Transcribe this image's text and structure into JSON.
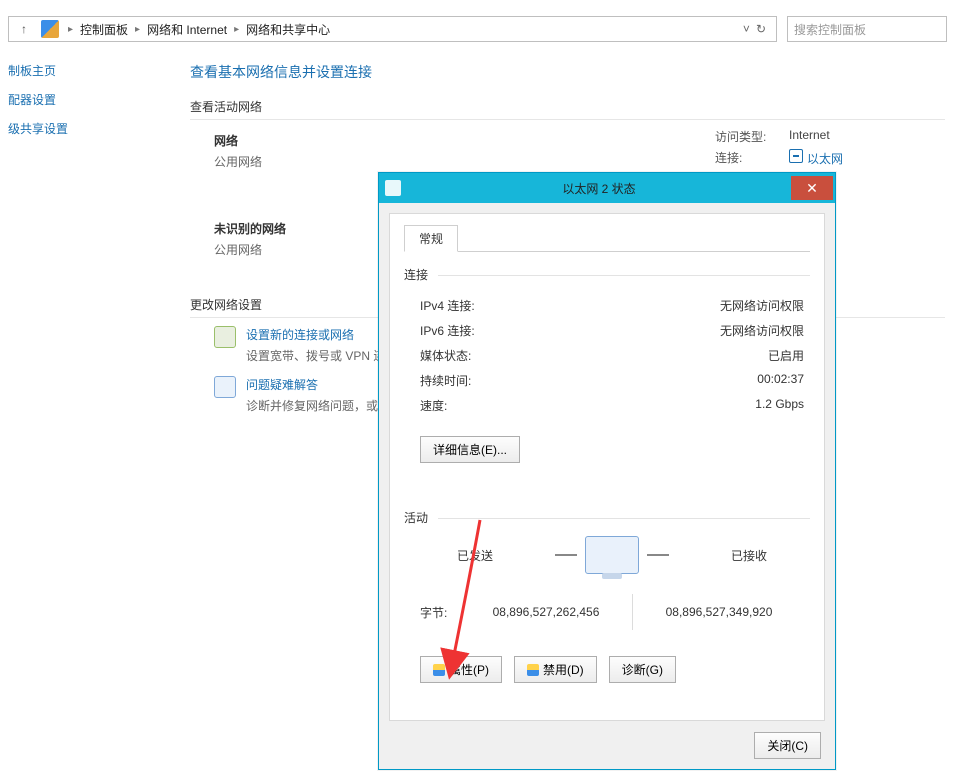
{
  "addressbar": {
    "crumbs": [
      "控制面板",
      "网络和 Internet",
      "网络和共享中心"
    ],
    "search_placeholder": "搜索控制面板"
  },
  "sidebar": {
    "items": [
      {
        "label": "制板主页"
      },
      {
        "label": "配器设置"
      },
      {
        "label": "级共享设置"
      }
    ]
  },
  "main": {
    "title": "查看基本网络信息并设置连接",
    "active_head": "查看活动网络",
    "net1": {
      "name": "网络",
      "type": "公用网络"
    },
    "net2": {
      "name": "未识别的网络",
      "type": "公用网络"
    },
    "access": {
      "access_lbl": "访问类型:",
      "access_val": "Internet",
      "conn_lbl": "连接:",
      "conn_val": "以太网"
    },
    "change_head": "更改网络设置",
    "task_setup": {
      "title": "设置新的连接或网络",
      "desc": "设置宽带、拨号或 VPN 连"
    },
    "task_trouble": {
      "title": "问题疑难解答",
      "desc": "诊断并修复网络问题，或者"
    }
  },
  "dialog": {
    "title": "以太网 2 状态",
    "tab": "常规",
    "section_conn": "连接",
    "rows": {
      "ipv4_k": "IPv4 连接:",
      "ipv4_v": "无网络访问权限",
      "ipv6_k": "IPv6 连接:",
      "ipv6_v": "无网络访问权限",
      "media_k": "媒体状态:",
      "media_v": "已启用",
      "dur_k": "持续时间:",
      "dur_v": "00:02:37",
      "speed_k": "速度:",
      "speed_v": "1.2 Gbps"
    },
    "details_btn": "详细信息(E)...",
    "section_act": "活动",
    "sent_lbl": "已发送",
    "recv_lbl": "已接收",
    "bytes_lbl": "字节:",
    "sent_bytes": "08,896,527,262,456",
    "recv_bytes": "08,896,527,349,920",
    "btn_props": "属性(P)",
    "btn_disable": "禁用(D)",
    "btn_diag": "诊断(G)",
    "btn_close": "关闭(C)"
  }
}
